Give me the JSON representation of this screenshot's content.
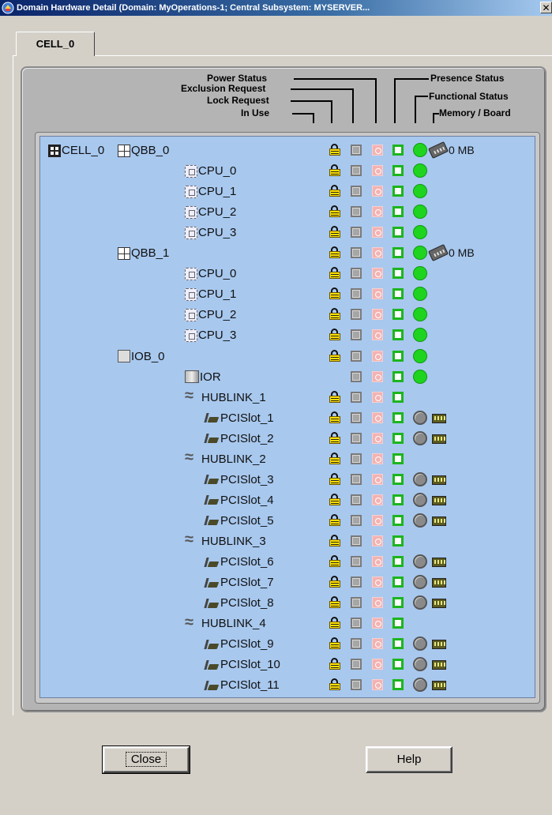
{
  "window": {
    "title": "Domain Hardware Detail (Domain: MyOperations-1; Central Subsystem: MYSERVER...",
    "close_glyph": "✕"
  },
  "tab": {
    "label": "CELL_0"
  },
  "headers": {
    "power_status": "Power Status",
    "exclusion_request": "Exclusion Request",
    "lock_request": "Lock Request",
    "in_use": "In Use",
    "presence_status": "Presence Status",
    "functional_status": "Functional Status",
    "memory_board": "Memory / Board"
  },
  "tree": [
    {
      "label": "QBB_0",
      "icon": "qbb-icon",
      "level": 1,
      "prefix": "CELL_0",
      "lock": true,
      "func": true,
      "memory": "0 MB"
    },
    {
      "label": "CPU_0",
      "icon": "cpu-icon",
      "level": 2,
      "lock": true,
      "func": true
    },
    {
      "label": "CPU_1",
      "icon": "cpu-icon",
      "level": 2,
      "lock": true,
      "func": true
    },
    {
      "label": "CPU_2",
      "icon": "cpu-icon",
      "level": 2,
      "lock": true,
      "func": true
    },
    {
      "label": "CPU_3",
      "icon": "cpu-icon",
      "level": 2,
      "lock": true,
      "func": true
    },
    {
      "label": "QBB_1",
      "icon": "qbb-icon",
      "level": 1,
      "lock": true,
      "func": true,
      "memory": "0 MB"
    },
    {
      "label": "CPU_0",
      "icon": "cpu-icon",
      "level": 2,
      "lock": true,
      "func": true
    },
    {
      "label": "CPU_1",
      "icon": "cpu-icon",
      "level": 2,
      "lock": true,
      "func": true
    },
    {
      "label": "CPU_2",
      "icon": "cpu-icon",
      "level": 2,
      "lock": true,
      "func": true
    },
    {
      "label": "CPU_3",
      "icon": "cpu-icon",
      "level": 2,
      "lock": true,
      "func": true
    },
    {
      "label": "IOB_0",
      "icon": "iob-icon",
      "level": 1,
      "lock": true,
      "func": true
    },
    {
      "label": "IOR",
      "icon": "ior-icon",
      "level": 2,
      "lock": false,
      "func": true
    },
    {
      "label": "HUBLINK_1",
      "icon": "hublink-icon",
      "level": 2,
      "lock": true,
      "func": false
    },
    {
      "label": "PCISlot_1",
      "icon": "pci-slot-icon",
      "level": 3,
      "lock": true,
      "slot": true
    },
    {
      "label": "PCISlot_2",
      "icon": "pci-slot-icon",
      "level": 3,
      "lock": true,
      "slot": true
    },
    {
      "label": "HUBLINK_2",
      "icon": "hublink-icon",
      "level": 2,
      "lock": true,
      "func": false
    },
    {
      "label": "PCISlot_3",
      "icon": "pci-slot-icon",
      "level": 3,
      "lock": true,
      "slot": true
    },
    {
      "label": "PCISlot_4",
      "icon": "pci-slot-icon",
      "level": 3,
      "lock": true,
      "slot": true
    },
    {
      "label": "PCISlot_5",
      "icon": "pci-slot-icon",
      "level": 3,
      "lock": true,
      "slot": true
    },
    {
      "label": "HUBLINK_3",
      "icon": "hublink-icon",
      "level": 2,
      "lock": true,
      "func": false
    },
    {
      "label": "PCISlot_6",
      "icon": "pci-slot-icon",
      "level": 3,
      "lock": true,
      "slot": true
    },
    {
      "label": "PCISlot_7",
      "icon": "pci-slot-icon",
      "level": 3,
      "lock": true,
      "slot": true
    },
    {
      "label": "PCISlot_8",
      "icon": "pci-slot-icon",
      "level": 3,
      "lock": true,
      "slot": true
    },
    {
      "label": "HUBLINK_4",
      "icon": "hublink-icon",
      "level": 2,
      "lock": true,
      "func": false
    },
    {
      "label": "PCISlot_9",
      "icon": "pci-slot-icon",
      "level": 3,
      "lock": true,
      "slot": true
    },
    {
      "label": "PCISlot_10",
      "icon": "pci-slot-icon",
      "level": 3,
      "lock": true,
      "slot": true
    },
    {
      "label": "PCISlot_11",
      "icon": "pci-slot-icon",
      "level": 3,
      "lock": true,
      "slot": true
    }
  ],
  "buttons": {
    "close": "Close",
    "help": "Help"
  },
  "colors": {
    "tree_bg": "#a8c8ee",
    "functional_ok": "#1fd41f",
    "presence": "#1db51d",
    "lock": "#ffe000"
  }
}
